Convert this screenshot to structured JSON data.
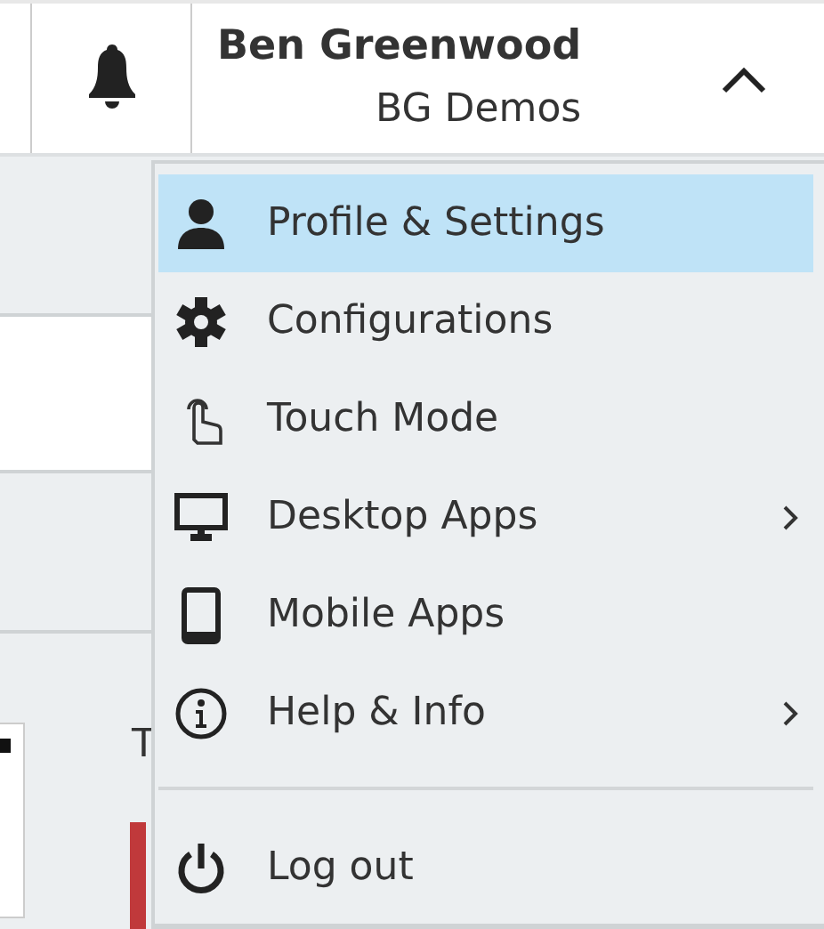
{
  "header": {
    "user_name": "Ben Greenwood",
    "organization": "BG Demos",
    "expanded": true
  },
  "background": {
    "partial_text": "T"
  },
  "user_menu": [
    {
      "label": "Profile & Settings",
      "selected": true,
      "submenu": false,
      "divider_before": false
    },
    {
      "label": "Configurations",
      "selected": false,
      "submenu": false,
      "divider_before": false
    },
    {
      "label": "Touch Mode",
      "selected": false,
      "submenu": false,
      "divider_before": false
    },
    {
      "label": "Desktop Apps",
      "selected": false,
      "submenu": true,
      "divider_before": false
    },
    {
      "label": "Mobile Apps",
      "selected": false,
      "submenu": false,
      "divider_before": false
    },
    {
      "label": "Help & Info",
      "selected": false,
      "submenu": true,
      "divider_before": false
    },
    {
      "label": "Log out",
      "selected": false,
      "submenu": false,
      "divider_before": true
    }
  ]
}
